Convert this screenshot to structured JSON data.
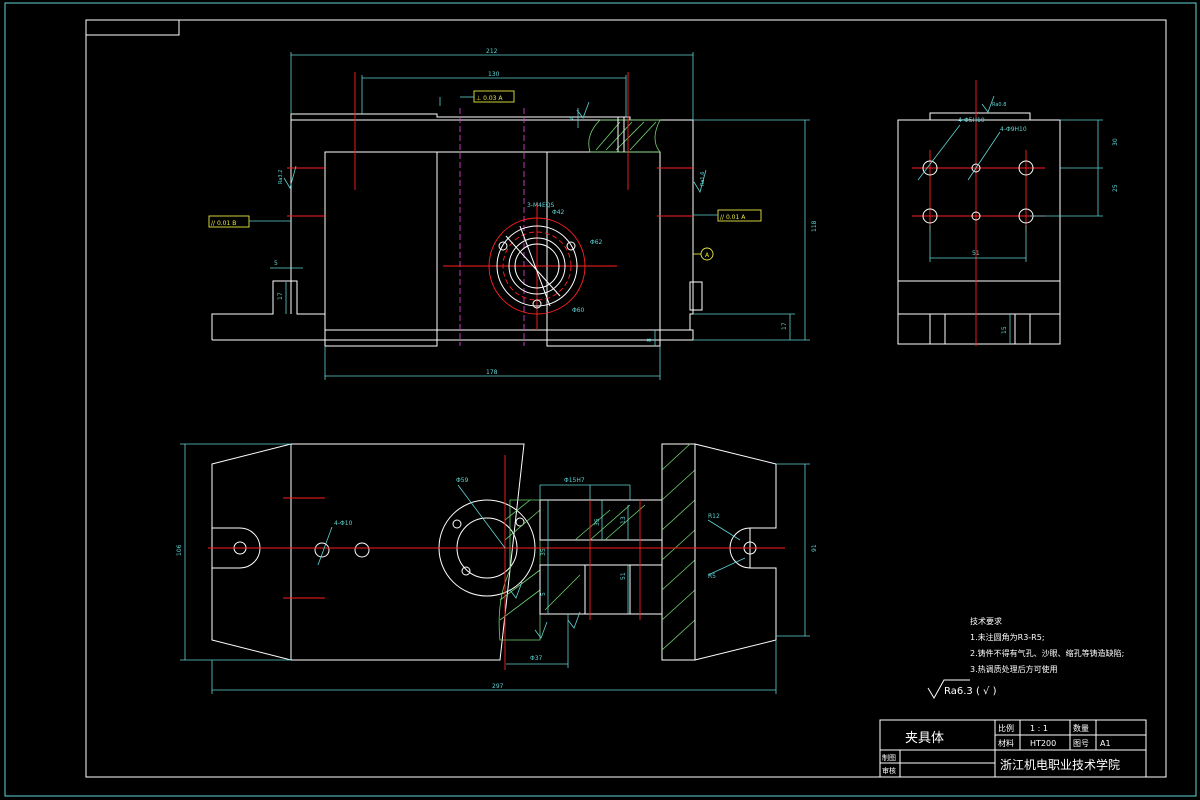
{
  "dimensions": {
    "front_overall": "212",
    "front_hole_span": "130",
    "front_bottom": "178",
    "front_height": "118",
    "front_right_small": "17",
    "front_right_tiny": "8",
    "front_left_small": "17",
    "front_left_tiny": "5",
    "front_top_tiny": "4",
    "side_top": "30",
    "side_mid": "25",
    "side_width": "51",
    "side_bottom": "15",
    "plan_overall": "297",
    "plan_height": "106",
    "plan_right_height": "91",
    "plan_d1": "35",
    "plan_d2": "13",
    "plan_d3": "35",
    "plan_d4": "5",
    "plan_d5": "51"
  },
  "annotations": {
    "tol_left": "// 0.01 B",
    "tol_right": "// 0.01 A",
    "tol_top": "⊥ 0.03 A",
    "datum_b": "B",
    "datum_a": "A",
    "holes_3": "3-M4EQS",
    "dia_62": "Φ62",
    "dia_60": "Φ60",
    "dia_42": "Φ42",
    "side_holes_a": "4-Φ5H10",
    "side_holes_b": "4-Φ9H10",
    "plan_dia_59": "Φ59",
    "plan_dia_37": "Φ37",
    "plan_dia_15": "Φ15H7",
    "plan_holes": "4-Φ10",
    "r12": "R12",
    "r5": "R5",
    "rough_1": "Ra3.2",
    "rough_2": "Ra1.6",
    "rough_3": "Ra0.8"
  },
  "notes": {
    "title": "技术要求",
    "line1": "1.未注圆角为R3-R5;",
    "line2": "2.铸件不得有气孔、沙眼、缩孔等铸造缺陷;",
    "line3": "3.热调质处理后方可使用"
  },
  "roughness_general": "Ra6.3 ( √ )",
  "title_block": {
    "part_name": "夹具体",
    "scale_label": "比例",
    "scale_value": "1 : 1",
    "qty_label": "数量",
    "material_label": "材料",
    "material_value": "HT200",
    "drawing_no_label": "图号",
    "drawing_no_value": "A1",
    "designer_label": "制图",
    "checker_label": "审核",
    "school": "浙江机电职业技术学院"
  }
}
